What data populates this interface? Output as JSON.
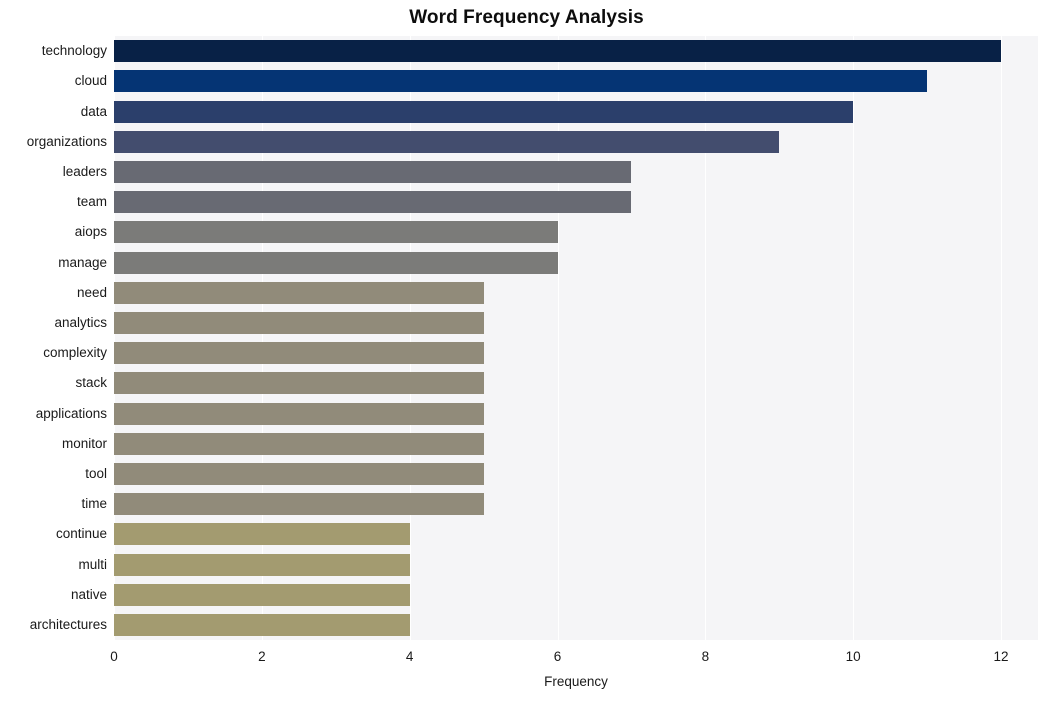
{
  "chart_data": {
    "type": "bar",
    "orientation": "horizontal",
    "title": "Word Frequency Analysis",
    "xlabel": "Frequency",
    "ylabel": "",
    "categories": [
      "technology",
      "cloud",
      "data",
      "organizations",
      "leaders",
      "team",
      "aiops",
      "manage",
      "need",
      "analytics",
      "complexity",
      "stack",
      "applications",
      "monitor",
      "tool",
      "time",
      "continue",
      "multi",
      "native",
      "architectures"
    ],
    "values": [
      12,
      11,
      10,
      9,
      7,
      7,
      6,
      6,
      5,
      5,
      5,
      5,
      5,
      5,
      5,
      5,
      4,
      4,
      4,
      4
    ],
    "bar_colors": [
      "#082146",
      "#053474",
      "#2b3f6b",
      "#434d6e",
      "#686a73",
      "#686a73",
      "#7b7b79",
      "#7b7b79",
      "#918b7a",
      "#918b7a",
      "#918b7a",
      "#918b7a",
      "#918b7a",
      "#918b7a",
      "#918b7a",
      "#918b7a",
      "#a39b70",
      "#a39b70",
      "#a39b70",
      "#a39b70"
    ],
    "xticks": [
      0,
      2,
      4,
      6,
      8,
      10,
      12
    ],
    "xlim": [
      0,
      12.5
    ],
    "grid": true,
    "grid_color": "#ffffff",
    "plot_background": "#f5f5f7",
    "figure_background": "#ffffff",
    "legend": null
  }
}
